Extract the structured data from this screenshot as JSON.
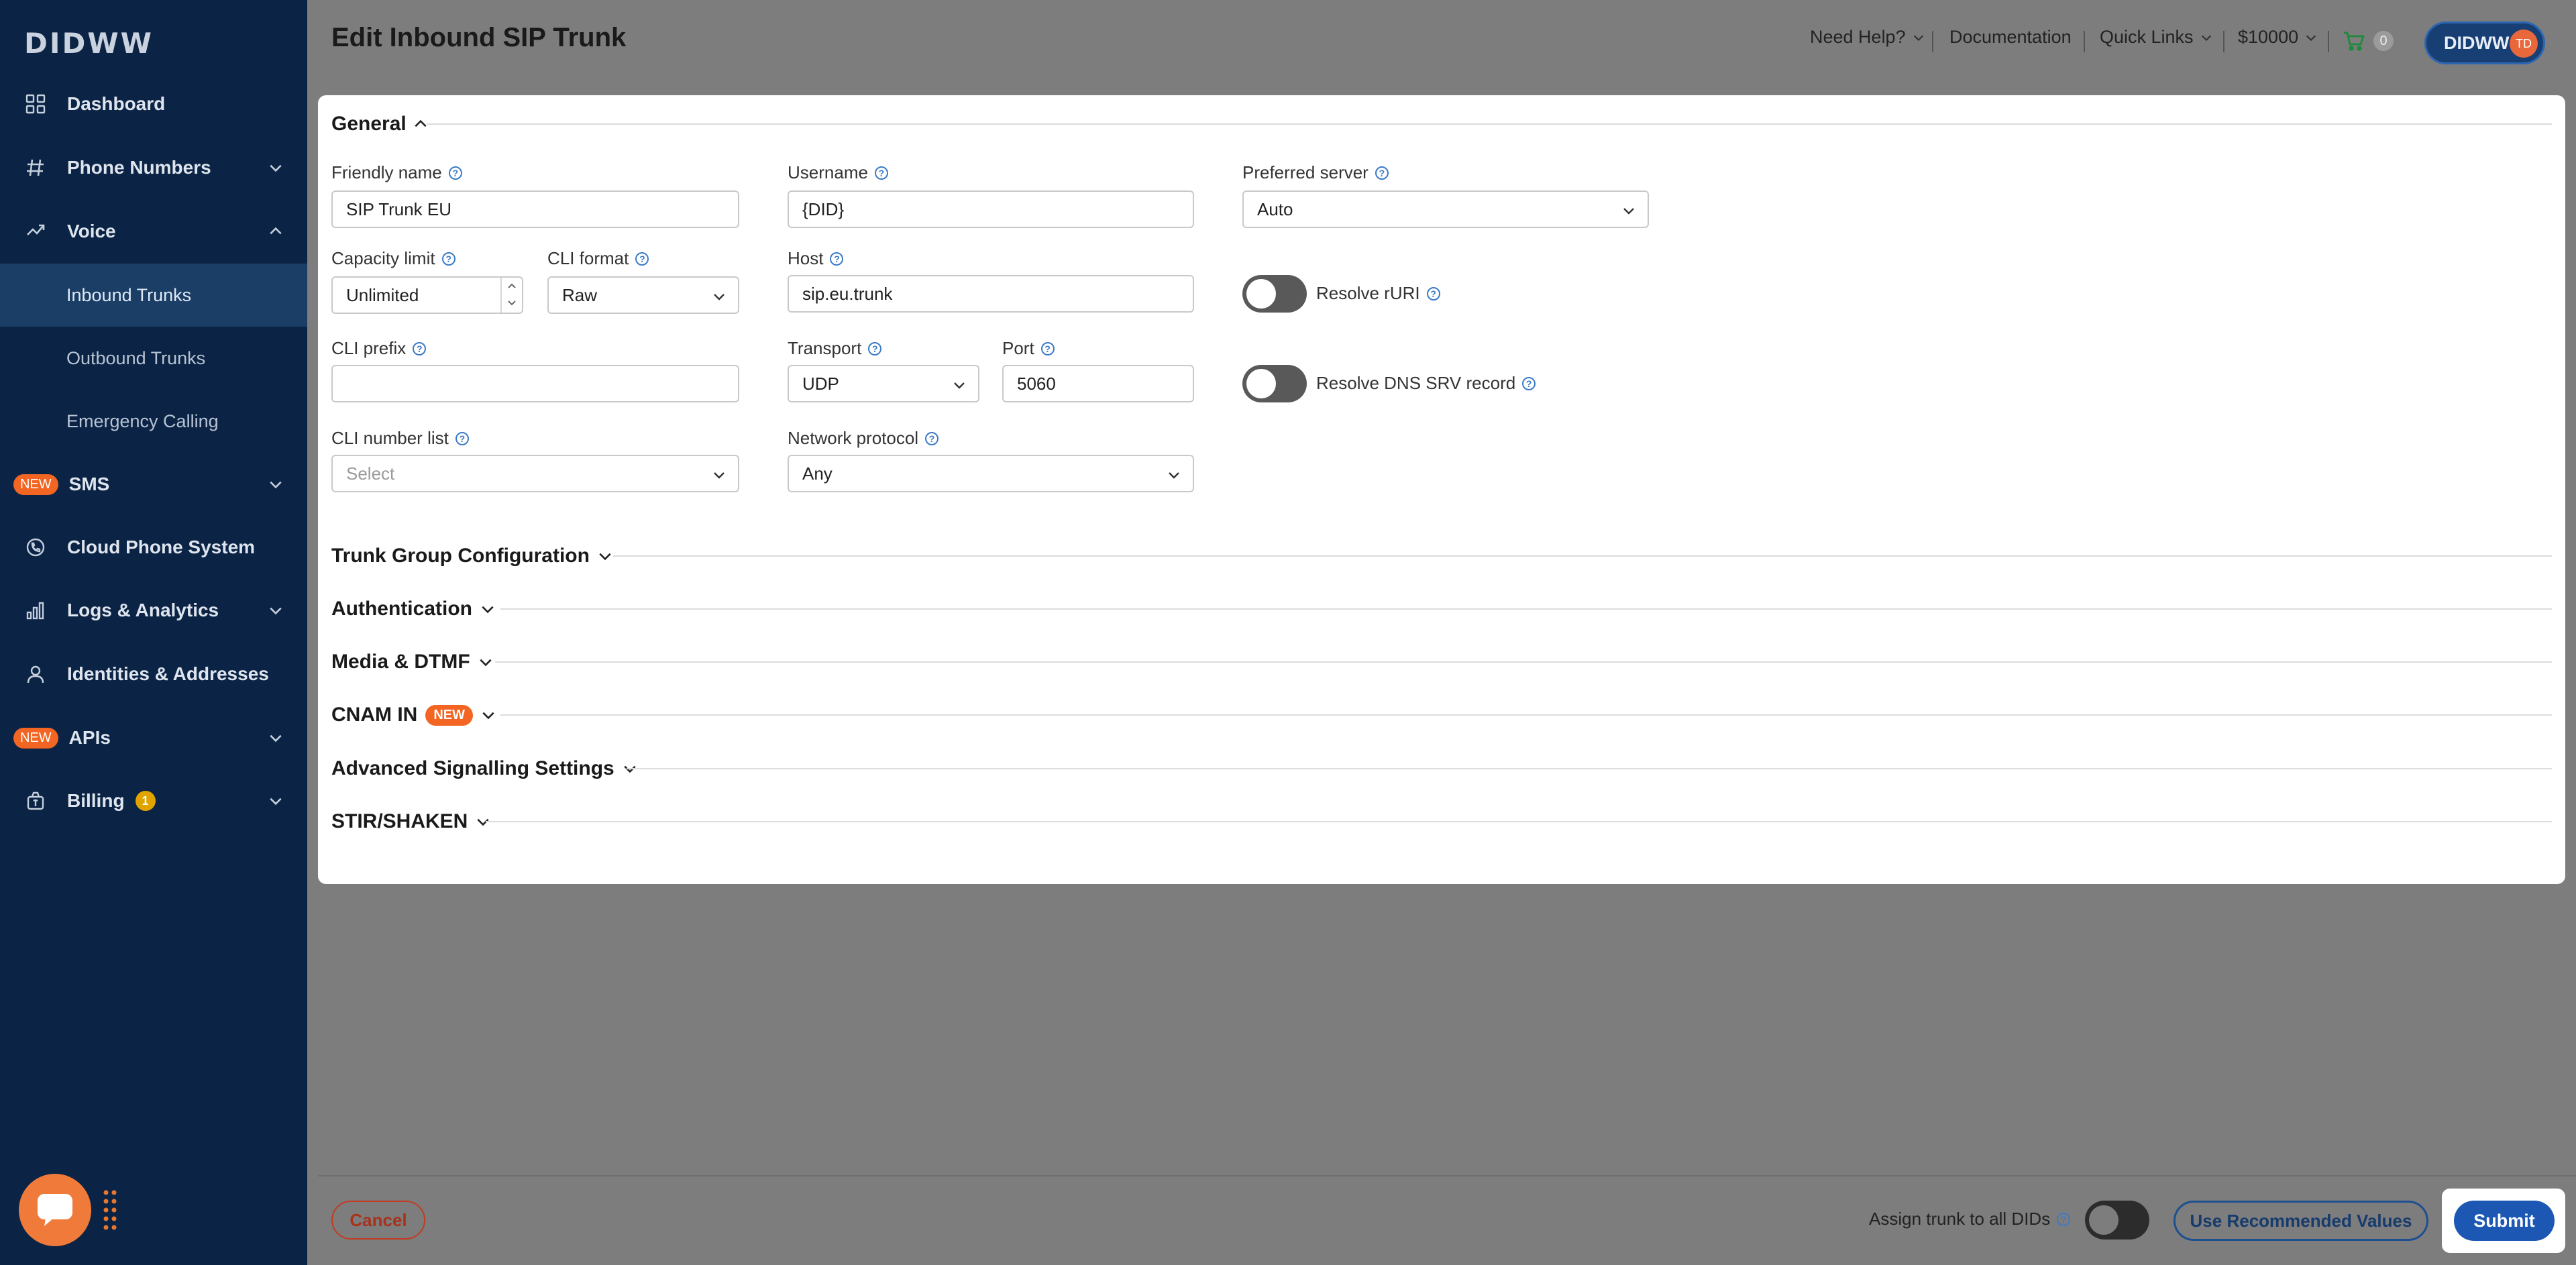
{
  "brand": "DIDWW",
  "sidebar": {
    "items": [
      {
        "label": "Dashboard",
        "icon": "grid-icon"
      },
      {
        "label": "Phone Numbers",
        "icon": "hash-icon"
      },
      {
        "label": "Voice",
        "icon": "voice-icon"
      },
      {
        "label": "Inbound Trunks"
      },
      {
        "label": "Outbound Trunks"
      },
      {
        "label": "Emergency Calling"
      },
      {
        "label": "SMS",
        "badge": "NEW"
      },
      {
        "label": "Cloud Phone System",
        "icon": "phone-icon"
      },
      {
        "label": "Logs & Analytics",
        "icon": "bar-chart-icon"
      },
      {
        "label": "Identities & Addresses",
        "icon": "person-icon"
      },
      {
        "label": "APIs",
        "badge": "NEW"
      },
      {
        "label": "Billing",
        "icon": "money-bag-icon",
        "count": "1"
      }
    ]
  },
  "header": {
    "title": "Edit Inbound SIP Trunk",
    "need_help": "Need Help?",
    "documentation": "Documentation",
    "quick_links": "Quick Links",
    "balance": "$10000",
    "cart_count": "0",
    "account": "DIDWW",
    "avatar_initials": "TD"
  },
  "general": {
    "title": "General",
    "friendly_name": {
      "label": "Friendly name",
      "value": "SIP Trunk EU"
    },
    "username": {
      "label": "Username",
      "value": "{DID}"
    },
    "preferred_server": {
      "label": "Preferred server",
      "value": "Auto"
    },
    "capacity_limit": {
      "label": "Capacity limit",
      "value": "Unlimited"
    },
    "cli_format": {
      "label": "CLI format",
      "value": "Raw"
    },
    "host": {
      "label": "Host",
      "value": "sip.eu.trunk"
    },
    "resolve_ruri": {
      "label": "Resolve rURI"
    },
    "cli_prefix": {
      "label": "CLI prefix",
      "value": ""
    },
    "transport": {
      "label": "Transport",
      "value": "UDP"
    },
    "port": {
      "label": "Port",
      "value": "5060"
    },
    "resolve_dns": {
      "label": "Resolve DNS SRV record"
    },
    "cli_number_list": {
      "label": "CLI number list",
      "placeholder": "Select"
    },
    "network_protocol": {
      "label": "Network protocol",
      "value": "Any"
    }
  },
  "sections": [
    {
      "title": "Trunk Group Configuration"
    },
    {
      "title": "Authentication"
    },
    {
      "title": "Media & DTMF"
    },
    {
      "title": "CNAM IN",
      "badge": "NEW"
    },
    {
      "title": "Advanced Signalling Settings"
    },
    {
      "title": "STIR/SHAKEN"
    }
  ],
  "footer": {
    "cancel": "Cancel",
    "assign_label": "Assign trunk to all DIDs",
    "recommended": "Use Recommended Values",
    "submit": "Submit"
  },
  "colors": {
    "sidebar": "#0b2445",
    "accent": "#1c57b3",
    "new_badge": "#f26522"
  }
}
